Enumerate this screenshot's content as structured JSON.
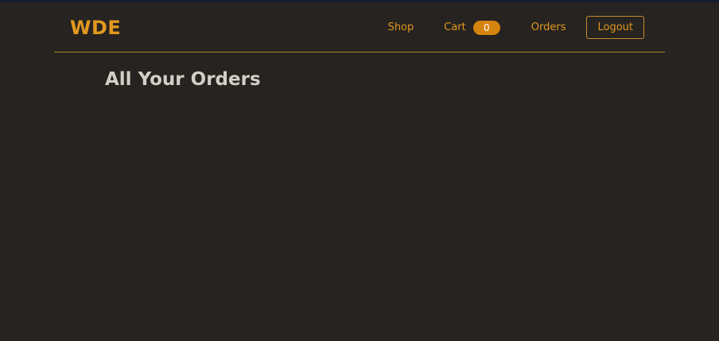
{
  "nav": {
    "brand": "WDE",
    "shop_label": "Shop",
    "cart_label": "Cart",
    "cart_count": "0",
    "orders_label": "Orders",
    "logout_label": "Logout"
  },
  "main": {
    "title": "All Your Orders"
  },
  "colors": {
    "accent": "#e2981f",
    "badge": "#d68410",
    "background": "#262320",
    "title_text": "#d4cec6"
  }
}
